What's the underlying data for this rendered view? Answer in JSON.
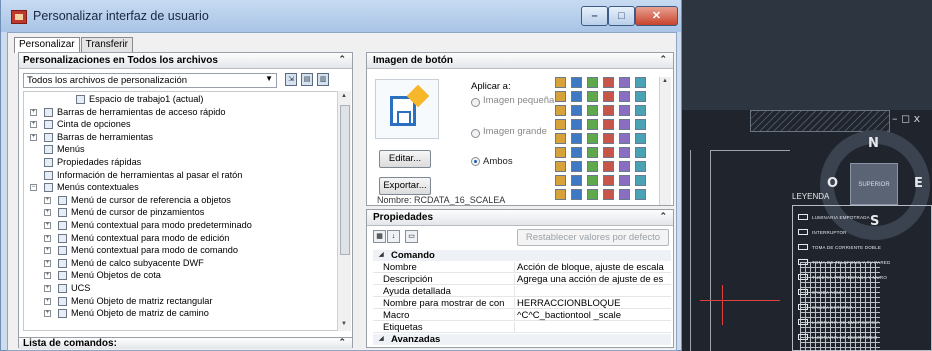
{
  "window": {
    "title": "Personalizar interfaz de usuario",
    "min_glyph": "–",
    "max_glyph": "□",
    "close_glyph": "✕"
  },
  "tabs": [
    {
      "label": "Personalizar",
      "active": true
    },
    {
      "label": "Transferir",
      "active": false
    }
  ],
  "left_panel": {
    "header": "Personalizaciones en Todos los archivos",
    "collapse_glyph": "⌃",
    "combo_value": "Todos los archivos de personalización",
    "combo_arrow": "▼",
    "tree": [
      {
        "label": "Espacio de trabajo1 (actual)",
        "indent": 52,
        "expander": ""
      },
      {
        "label": "Barras de herramientas de acceso rápido",
        "indent": 20,
        "expander": "+"
      },
      {
        "label": "Cinta de opciones",
        "indent": 20,
        "expander": "+"
      },
      {
        "label": "Barras de herramientas",
        "indent": 20,
        "expander": "+"
      },
      {
        "label": "Menús",
        "indent": 20,
        "expander": ""
      },
      {
        "label": "Propiedades rápidas",
        "indent": 20,
        "expander": ""
      },
      {
        "label": "Información de herramientas al pasar el ratón",
        "indent": 20,
        "expander": ""
      },
      {
        "label": "Menús contextuales",
        "indent": 20,
        "expander": "−"
      },
      {
        "label": "Menú de cursor de referencia a objetos",
        "indent": 34,
        "expander": "+"
      },
      {
        "label": "Menú de cursor de pinzamientos",
        "indent": 34,
        "expander": "+"
      },
      {
        "label": "Menú contextual para modo predeterminado",
        "indent": 34,
        "expander": "+"
      },
      {
        "label": "Menú contextual para modo de edición",
        "indent": 34,
        "expander": "+"
      },
      {
        "label": "Menú contextual para modo de comando",
        "indent": 34,
        "expander": "+"
      },
      {
        "label": "Menú de calco subyacente DWF",
        "indent": 34,
        "expander": "+"
      },
      {
        "label": "Menú Objetos de cota",
        "indent": 34,
        "expander": "+"
      },
      {
        "label": "UCS",
        "indent": 34,
        "expander": "+"
      },
      {
        "label": "Menú Objeto de matriz rectangular",
        "indent": 34,
        "expander": "+"
      },
      {
        "label": "Menú Objeto de matriz de camino",
        "indent": 34,
        "expander": "+"
      }
    ],
    "command_list_header": "Lista de comandos:",
    "command_list_collapse": "⌃"
  },
  "button_image_panel": {
    "header": "Imagen de botón",
    "collapse_glyph": "⌃",
    "apply_label": "Aplicar a:",
    "options": [
      {
        "label": "Imagen pequeña",
        "selected": false
      },
      {
        "label": "Imagen grande",
        "selected": false
      },
      {
        "label": "Ambos",
        "selected": true
      }
    ],
    "edit_button": "Editar...",
    "export_button": "Exportar...",
    "name_label": "Nombre: RCDATA_16_SCALEA"
  },
  "properties_panel": {
    "header": "Propiedades",
    "collapse_glyph": "⌃",
    "reset_button": "Restablecer valores por defecto",
    "categories": [
      {
        "name": "Comando",
        "rows": [
          {
            "name": "Nombre",
            "value": "Acción de bloque, ajuste de escala"
          },
          {
            "name": "Descripción",
            "value": "Agrega una acción de ajuste de es"
          },
          {
            "name": "Ayuda detallada",
            "value": ""
          },
          {
            "name": "Nombre para mostrar de con",
            "value": "HERRACCIONBLOQUE"
          },
          {
            "name": "Macro",
            "value": "^C^C_bactiontool _scale"
          },
          {
            "name": "Etiquetas",
            "value": ""
          }
        ]
      },
      {
        "name": "Avanzadas",
        "rows": []
      }
    ]
  },
  "cad": {
    "compass_north": "N",
    "compass_south": "S",
    "compass_east": "E",
    "compass_west": "O",
    "compass_center": "SUPERIOR",
    "viewport_controls": "– ◻ x",
    "legend_title": "LEYENDA",
    "legend_items": [
      "LUMINARIA EMPOTRADA",
      "INTERRUPTOR",
      "TOMA DE CORRIENTE DOBLE",
      "TOMA DE TELEFONO Y TV PARED",
      "TUBERIA PROYECTADA Y MURO",
      "SALIDA AGUA",
      "SALIDA EXTERNA",
      "LUMINARIA DE EMERGENCIA",
      "LUMINARIA DE ESCRITORIO"
    ]
  },
  "colors": {
    "titlebar_top": "#c7dbf2",
    "titlebar_bottom": "#a9c4e6",
    "close_button": "#c8432b",
    "cad_background": "#20252d",
    "accent_blue": "#2a6fc0"
  }
}
